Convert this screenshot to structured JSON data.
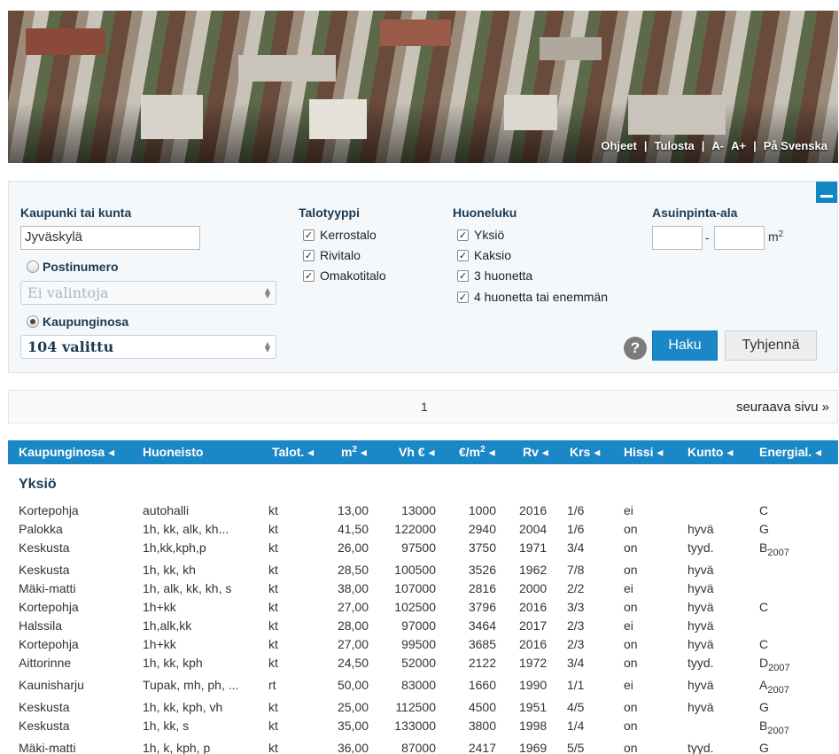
{
  "banner": {
    "links": [
      "Ohjeet",
      "|",
      "Tulosta",
      "|",
      "A-",
      "A+",
      "|",
      "På Svenska"
    ]
  },
  "search": {
    "city_label": "Kaupunki tai kunta",
    "city_value": "Jyväskylä",
    "postal_label": "Postinumero",
    "postal_select": "Ei valintoja",
    "district_label": "Kaupunginosa",
    "district_select": "104 valittu",
    "house_type_label": "Talotyyppi",
    "house_types": [
      "Kerrostalo",
      "Rivitalo",
      "Omakotitalo"
    ],
    "rooms_label": "Huoneluku",
    "rooms": [
      "Yksiö",
      "Kaksio",
      "3 huonetta",
      "4 huonetta tai enemmän"
    ],
    "area_label": "Asuinpinta-ala",
    "area_sep": "-",
    "area_unit": "m",
    "area_unit_sup": "2",
    "help": "?",
    "search_button": "Haku",
    "clear_button": "Tyhjennä",
    "accent_color": "#1a87c6"
  },
  "pager": {
    "page": "1",
    "next": "seuraava sivu »"
  },
  "table": {
    "headers": {
      "district": "Kaupunginosa ◂",
      "apartment": "Huoneisto",
      "type": "Talot. ◂",
      "m2": "m",
      "m2_sup": "2",
      "m2_arrow": "◂",
      "price": "Vh € ◂",
      "per_m2": "€/m",
      "per_m2_sup": "2",
      "per_m2_arrow": "◂",
      "year": "Rv ◂",
      "floor": "Krs ◂",
      "elevator": "Hissi ◂",
      "condition": "Kunto ◂",
      "energy": "Energial. ◂"
    },
    "group": "Yksiö",
    "rows": [
      {
        "d": "Kortepohja",
        "a": "autohalli",
        "t": "kt",
        "m": "13,00",
        "p": "13000",
        "pm": "1000",
        "y": "2016",
        "f": "1/6",
        "e": "ei",
        "c": "",
        "en": "C",
        "ens": ""
      },
      {
        "d": "Palokka",
        "a": "1h, kk, alk, kh...",
        "t": "kt",
        "m": "41,50",
        "p": "122000",
        "pm": "2940",
        "y": "2004",
        "f": "1/6",
        "e": "on",
        "c": "hyvä",
        "en": "G",
        "ens": ""
      },
      {
        "d": "Keskusta",
        "a": "1h,kk,kph,p",
        "t": "kt",
        "m": "26,00",
        "p": "97500",
        "pm": "3750",
        "y": "1971",
        "f": "3/4",
        "e": "on",
        "c": "tyyd.",
        "en": "B",
        "ens": "2007"
      },
      {
        "d": "Keskusta",
        "a": "1h, kk, kh",
        "t": "kt",
        "m": "28,50",
        "p": "100500",
        "pm": "3526",
        "y": "1962",
        "f": "7/8",
        "e": "on",
        "c": "hyvä",
        "en": "",
        "ens": ""
      },
      {
        "d": "Mäki-matti",
        "a": "1h, alk, kk, kh, s",
        "t": "kt",
        "m": "38,00",
        "p": "107000",
        "pm": "2816",
        "y": "2000",
        "f": "2/2",
        "e": "ei",
        "c": "hyvä",
        "en": "",
        "ens": ""
      },
      {
        "d": "Kortepohja",
        "a": "1h+kk",
        "t": "kt",
        "m": "27,00",
        "p": "102500",
        "pm": "3796",
        "y": "2016",
        "f": "3/3",
        "e": "on",
        "c": "hyvä",
        "en": "C",
        "ens": ""
      },
      {
        "d": "Halssila",
        "a": "1h,alk,kk",
        "t": "kt",
        "m": "28,00",
        "p": "97000",
        "pm": "3464",
        "y": "2017",
        "f": "2/3",
        "e": "ei",
        "c": "hyvä",
        "en": "",
        "ens": ""
      },
      {
        "d": "Kortepohja",
        "a": "1h+kk",
        "t": "kt",
        "m": "27,00",
        "p": "99500",
        "pm": "3685",
        "y": "2016",
        "f": "2/3",
        "e": "on",
        "c": "hyvä",
        "en": "C",
        "ens": ""
      },
      {
        "d": "Aittorinne",
        "a": "1h, kk, kph",
        "t": "kt",
        "m": "24,50",
        "p": "52000",
        "pm": "2122",
        "y": "1972",
        "f": "3/4",
        "e": "on",
        "c": "tyyd.",
        "en": "D",
        "ens": "2007"
      },
      {
        "d": "Kaunisharju",
        "a": "Tupak, mh, ph, ...",
        "t": "rt",
        "m": "50,00",
        "p": "83000",
        "pm": "1660",
        "y": "1990",
        "f": "1/1",
        "e": "ei",
        "c": "hyvä",
        "en": "A",
        "ens": "2007"
      },
      {
        "d": "Keskusta",
        "a": "1h, kk, kph, vh",
        "t": "kt",
        "m": "25,00",
        "p": "112500",
        "pm": "4500",
        "y": "1951",
        "f": "4/5",
        "e": "on",
        "c": "hyvä",
        "en": "G",
        "ens": ""
      },
      {
        "d": "Keskusta",
        "a": "1h, kk, s",
        "t": "kt",
        "m": "35,00",
        "p": "133000",
        "pm": "3800",
        "y": "1998",
        "f": "1/4",
        "e": "on",
        "c": "",
        "en": "B",
        "ens": "2007"
      },
      {
        "d": "Mäki-matti",
        "a": "1h, k, kph, p",
        "t": "kt",
        "m": "36,00",
        "p": "87000",
        "pm": "2417",
        "y": "1969",
        "f": "5/5",
        "e": "on",
        "c": "tyyd.",
        "en": "G",
        "ens": ""
      }
    ]
  }
}
